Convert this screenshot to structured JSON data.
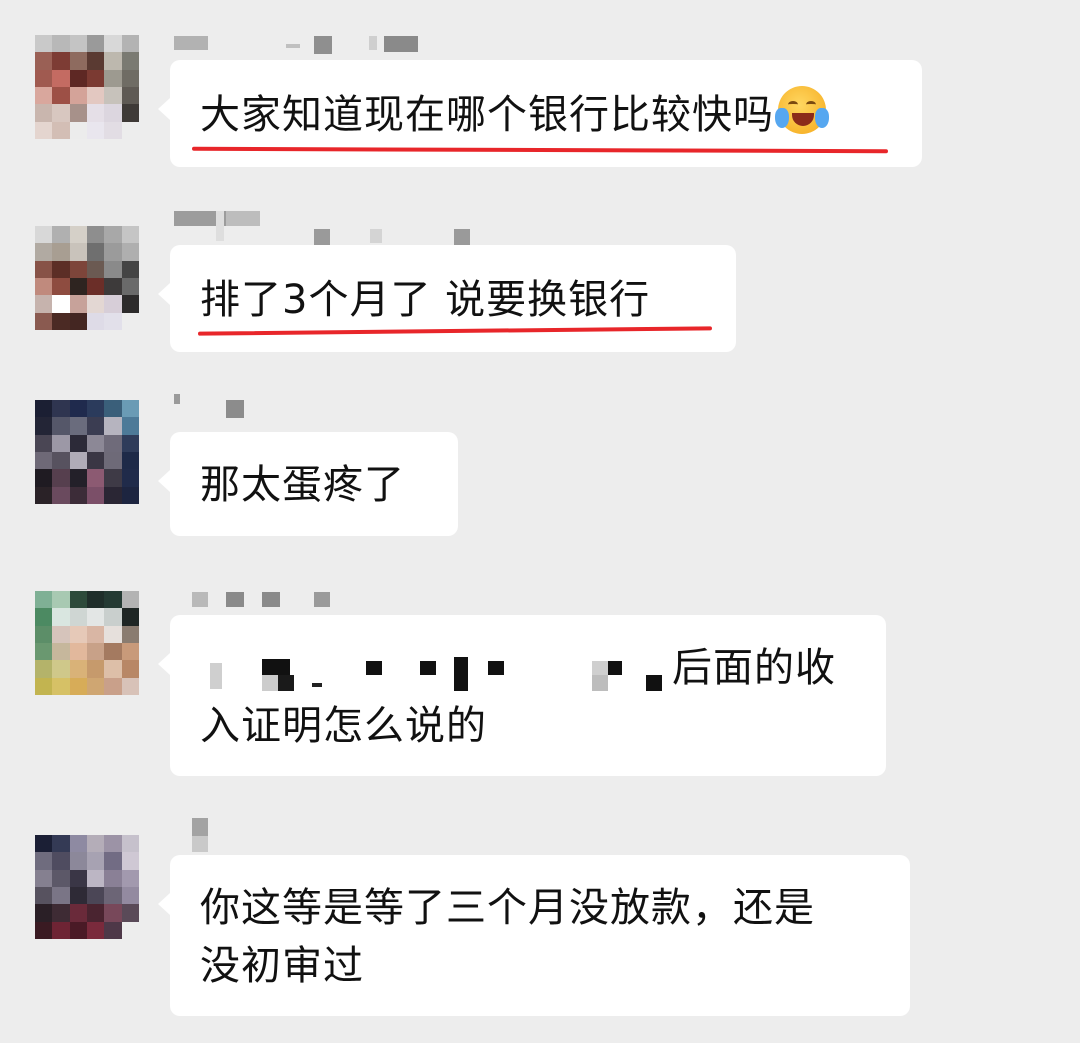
{
  "messages": [
    {
      "lines": [
        "大家知道现在哪个银行比较快吗"
      ],
      "emoji": "laughing-crying-emoji",
      "underlined": true
    },
    {
      "lines": [
        "排了3个月了 说要换银行"
      ],
      "underlined": true
    },
    {
      "lines": [
        "那太蛋疼了"
      ],
      "underlined": false
    },
    {
      "lines": [
        "后面的收",
        "入证明怎么说的"
      ],
      "redacted_prefix": true,
      "underlined": false
    },
    {
      "lines": [
        "你这等是等了三个月没放款，还是",
        "没初审过"
      ],
      "underlined": false
    }
  ],
  "colors": {
    "background": "#ededed",
    "bubble": "#ffffff",
    "underline": "#e8262a",
    "text": "#111111"
  }
}
